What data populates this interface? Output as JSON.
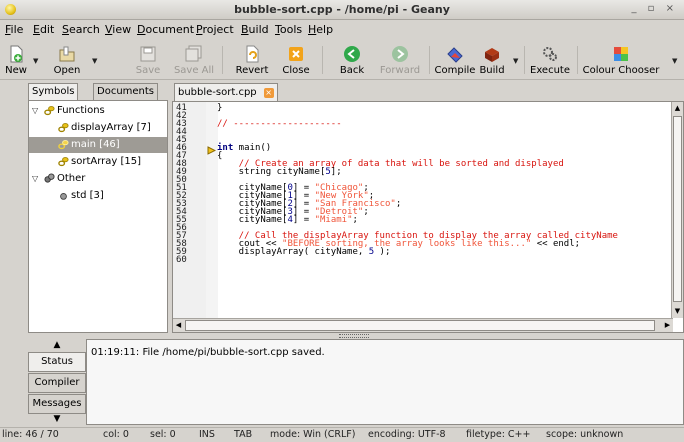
{
  "window": {
    "title": "bubble-sort.cpp - /home/pi - Geany",
    "buttons": "_ ▫ ×"
  },
  "menu": [
    "File",
    "Edit",
    "Search",
    "View",
    "Document",
    "Project",
    "Build",
    "Tools",
    "Help"
  ],
  "toolbar": {
    "new": "New",
    "open": "Open",
    "save": "Save",
    "save_all": "Save All",
    "revert": "Revert",
    "close": "Close",
    "back": "Back",
    "forward": "Forward",
    "compile": "Compile",
    "build": "Build",
    "execute": "Execute",
    "colour_chooser": "Colour Chooser"
  },
  "sidebar": {
    "tabs": [
      "Symbols",
      "Documents"
    ],
    "tree": [
      {
        "label": "Functions",
        "level": 0
      },
      {
        "label": "displayArray [7]",
        "level": 1
      },
      {
        "label": "main [46]",
        "level": 1,
        "selected": true
      },
      {
        "label": "sortArray [15]",
        "level": 1
      },
      {
        "label": "Other",
        "level": 0
      },
      {
        "label": "std [3]",
        "level": 1
      }
    ]
  },
  "editor": {
    "tab": "bubble-sort.cpp",
    "lines": [
      {
        "n": "41",
        "parts": [
          {
            "t": "txt",
            "s": "}"
          }
        ]
      },
      {
        "n": "42",
        "parts": []
      },
      {
        "n": "43",
        "parts": [
          {
            "t": "com",
            "s": "// --------------------"
          }
        ]
      },
      {
        "n": "44",
        "parts": []
      },
      {
        "n": "45",
        "parts": []
      },
      {
        "n": "46",
        "parts": [
          {
            "t": "kw",
            "s": "int"
          },
          {
            "t": "txt",
            "s": " main()"
          }
        ]
      },
      {
        "n": "47",
        "parts": [
          {
            "t": "txt",
            "s": "{"
          }
        ]
      },
      {
        "n": "48",
        "parts": [
          {
            "t": "com",
            "s": "    // Create an array of data that will be sorted and displayed"
          }
        ]
      },
      {
        "n": "49",
        "parts": [
          {
            "t": "txt",
            "s": "    string cityName["
          },
          {
            "t": "num",
            "s": "5"
          },
          {
            "t": "txt",
            "s": "];"
          }
        ]
      },
      {
        "n": "50",
        "parts": []
      },
      {
        "n": "51",
        "parts": [
          {
            "t": "txt",
            "s": "    cityName["
          },
          {
            "t": "num",
            "s": "0"
          },
          {
            "t": "txt",
            "s": "] = "
          },
          {
            "t": "str",
            "s": "\"Chicago\""
          },
          {
            "t": "txt",
            "s": ";"
          }
        ]
      },
      {
        "n": "52",
        "parts": [
          {
            "t": "txt",
            "s": "    cityName["
          },
          {
            "t": "num",
            "s": "1"
          },
          {
            "t": "txt",
            "s": "] = "
          },
          {
            "t": "str",
            "s": "\"New York\""
          },
          {
            "t": "txt",
            "s": ";"
          }
        ]
      },
      {
        "n": "53",
        "parts": [
          {
            "t": "txt",
            "s": "    cityName["
          },
          {
            "t": "num",
            "s": "2"
          },
          {
            "t": "txt",
            "s": "] = "
          },
          {
            "t": "str",
            "s": "\"San Francisco\""
          },
          {
            "t": "txt",
            "s": ";"
          }
        ]
      },
      {
        "n": "54",
        "parts": [
          {
            "t": "txt",
            "s": "    cityName["
          },
          {
            "t": "num",
            "s": "3"
          },
          {
            "t": "txt",
            "s": "] = "
          },
          {
            "t": "str",
            "s": "\"Detroit\""
          },
          {
            "t": "txt",
            "s": ";"
          }
        ]
      },
      {
        "n": "55",
        "parts": [
          {
            "t": "txt",
            "s": "    cityName["
          },
          {
            "t": "num",
            "s": "4"
          },
          {
            "t": "txt",
            "s": "] = "
          },
          {
            "t": "str",
            "s": "\"Miami\""
          },
          {
            "t": "txt",
            "s": ";"
          }
        ]
      },
      {
        "n": "56",
        "parts": []
      },
      {
        "n": "57",
        "parts": [
          {
            "t": "com",
            "s": "    // Call the displayArray function to display the array called cityName"
          }
        ]
      },
      {
        "n": "58",
        "parts": [
          {
            "t": "txt",
            "s": "    cout << "
          },
          {
            "t": "str",
            "s": "\"BEFORE sorting, the array looks like this...\""
          },
          {
            "t": "txt",
            "s": " << endl;"
          }
        ]
      },
      {
        "n": "59",
        "parts": [
          {
            "t": "txt",
            "s": "    displayArray( cityName, "
          },
          {
            "t": "num",
            "s": "5"
          },
          {
            "t": "txt",
            "s": " );"
          }
        ]
      },
      {
        "n": "60",
        "parts": []
      }
    ]
  },
  "messages": {
    "tabs": [
      "Status",
      "Compiler",
      "Messages"
    ],
    "text": "01:19:11: File /home/pi/bubble-sort.cpp saved."
  },
  "status": {
    "line": "line: 46 / 70",
    "col": "col: 0",
    "sel": "sel: 0",
    "ins": "INS",
    "tab": "TAB",
    "mode": "mode: Win (CRLF)",
    "encoding": "encoding: UTF-8",
    "filetype": "filetype: C++",
    "scope": "scope: unknown"
  }
}
